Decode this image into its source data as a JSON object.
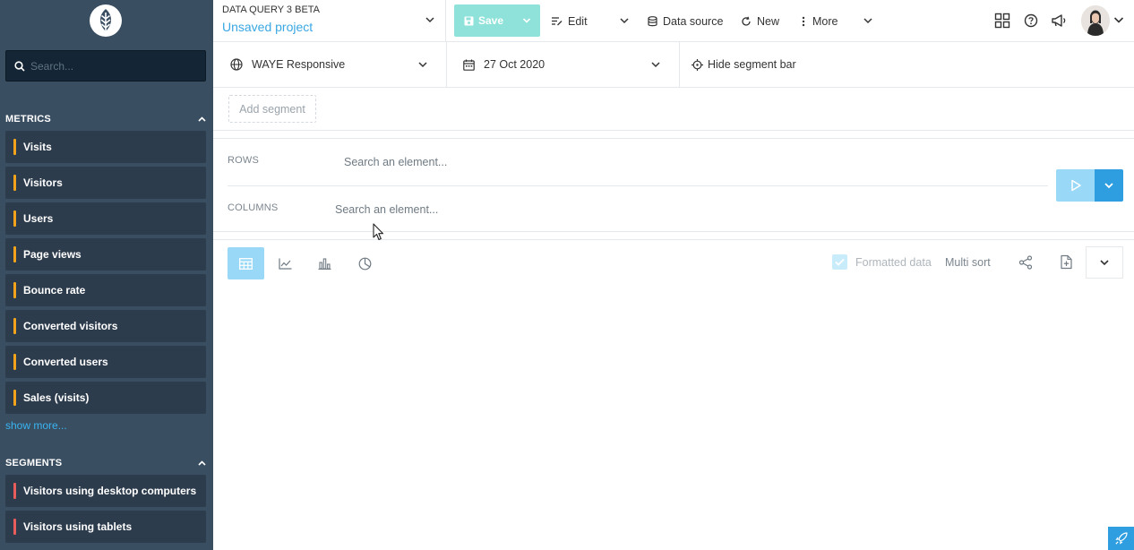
{
  "sidebar": {
    "search": {
      "placeholder": "Search..."
    },
    "metrics_header": "METRICS",
    "metrics": [
      {
        "label": "Visits"
      },
      {
        "label": "Visitors"
      },
      {
        "label": "Users"
      },
      {
        "label": "Page views"
      },
      {
        "label": "Bounce rate"
      },
      {
        "label": "Converted visitors"
      },
      {
        "label": "Converted users"
      },
      {
        "label": "Sales (visits)"
      }
    ],
    "show_more": "show more...",
    "segments_header": "SEGMENTS",
    "segments": [
      {
        "label": "Visitors using desktop computers"
      },
      {
        "label": "Visitors using tablets"
      }
    ]
  },
  "header": {
    "kicker": "DATA QUERY 3 BETA",
    "project_name": "Unsaved project",
    "save_label": "Save",
    "edit_label": "Edit",
    "datasource_label": "Data source",
    "new_label": "New",
    "more_label": "More"
  },
  "filters": {
    "site": "WAYE Responsive",
    "date": "27 Oct 2020",
    "hide_segment_bar": "Hide segment bar"
  },
  "segment_bar": {
    "add_segment": "Add segment"
  },
  "query": {
    "rows_label": "ROWS",
    "rows_placeholder": "Search an element...",
    "columns_label": "COLUMNS",
    "columns_placeholder": "Search an element..."
  },
  "viz_toolbar": {
    "formatted_data": "Formatted data",
    "formatted_checked": true,
    "multi_sort": "Multi sort"
  },
  "colors": {
    "sidebar_bg": "#3a4e62",
    "sidebar_item_bg": "#2d3c4d",
    "metric_accent": "#f2a21b",
    "segment_accent": "#e85c5c",
    "link": "#39b4f0",
    "save_button": "#8ee2d9",
    "primary": "#2e9ee0",
    "project_name": "#39a7e2"
  },
  "icons": {
    "logo": "leaf-logo-icon",
    "search": "search-icon",
    "apps": "grid-icon",
    "help": "help-icon",
    "announcements": "megaphone-icon"
  }
}
